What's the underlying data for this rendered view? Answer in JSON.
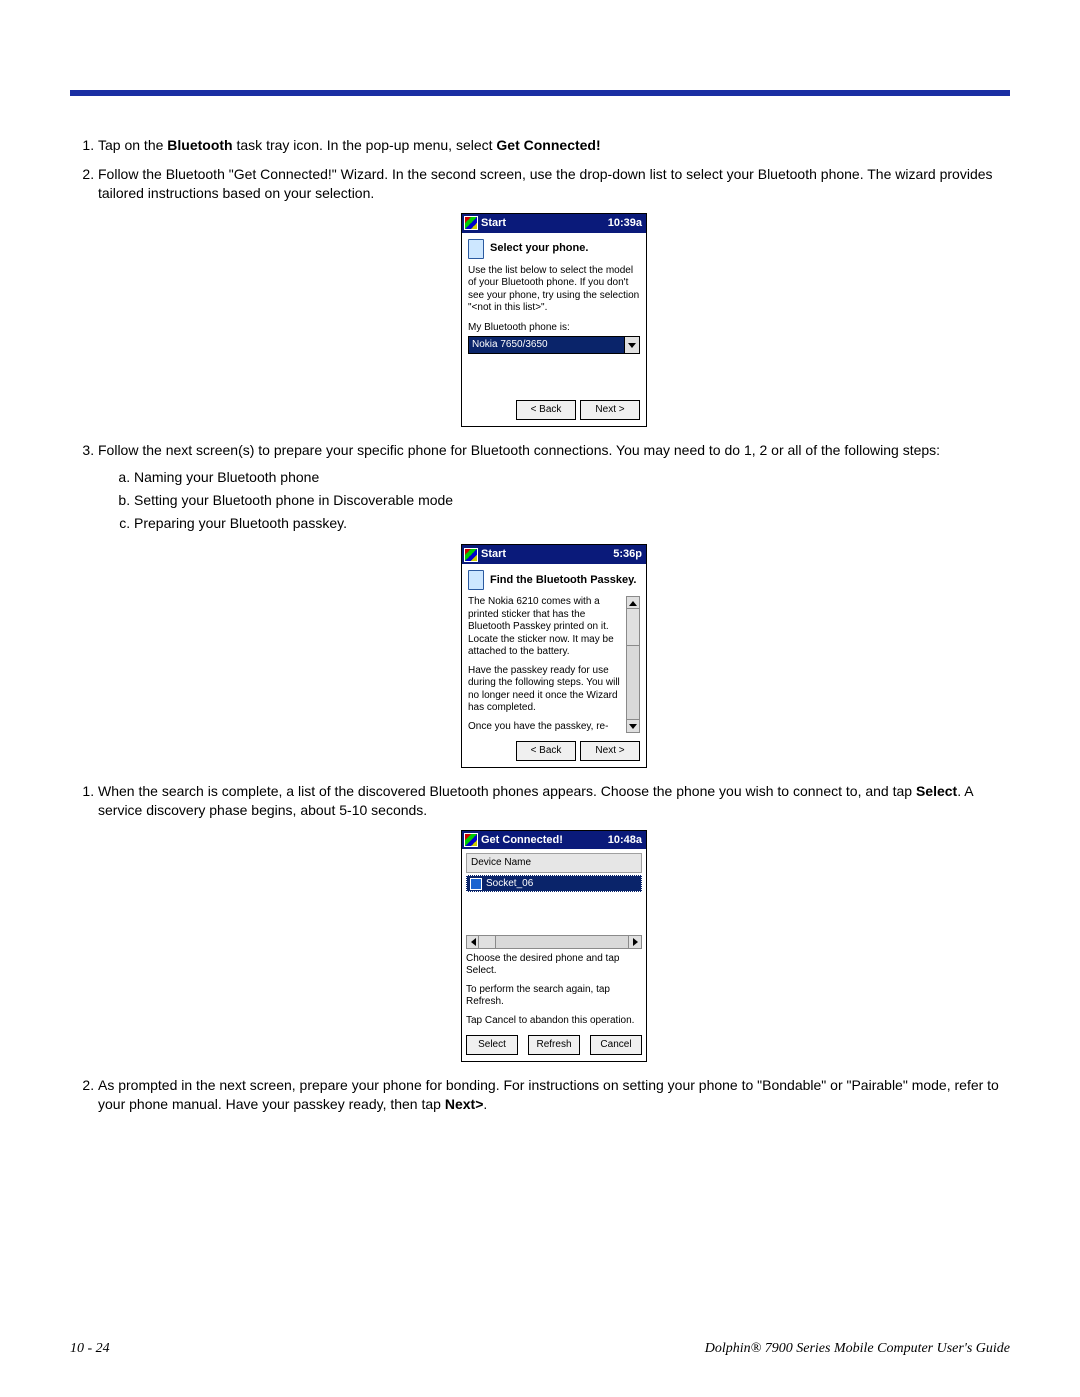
{
  "steps_a": {
    "s1_pre": "Tap on the ",
    "s1_bold1": "Bluetooth",
    "s1_mid": " task tray icon. In the pop-up menu, select ",
    "s1_bold2": "Get Connected!",
    "s2": "Follow the Bluetooth \"Get Connected!\" Wizard. In the second screen, use the drop-down list to select your Bluetooth phone. The wizard provides tailored instructions based on your selection.",
    "s3": "Follow the next screen(s) to prepare your specific phone for Bluetooth connections. You may need to do 1, 2 or all of the following steps:",
    "s3a": "Naming your Bluetooth phone",
    "s3b": "Setting your Bluetooth phone in Discoverable mode",
    "s3c": "Preparing your Bluetooth passkey."
  },
  "steps_b": {
    "s1_pre": "When the search is complete, a list of the discovered Bluetooth phones appears. Choose the phone you wish to connect to, and tap ",
    "s1_bold": "Select",
    "s1_post": ". A service discovery phase begins, about 5-10 seconds.",
    "s2_pre": "As prompted in the next screen, prepare your phone for bonding. For instructions on setting your phone to \"Bondable\" or \"Pairable\" mode, refer to your phone manual. Have your passkey ready, then tap ",
    "s2_bold": "Next>",
    "s2_post": "."
  },
  "pda1": {
    "title": "Start",
    "time": "10:39a",
    "heading": "Select your phone.",
    "text": "Use the list below to select the model of your Bluetooth phone. If you don't see your phone, try using the selection \"<not in this list>\".",
    "label": "My Bluetooth phone is:",
    "select_value": "Nokia 7650/3650",
    "btn_back": "< Back",
    "btn_next": "Next >"
  },
  "pda2": {
    "title": "Start",
    "time": "5:36p",
    "heading": "Find the Bluetooth Passkey.",
    "text1": "The Nokia 6210 comes with a printed sticker that has the Bluetooth Passkey printed on it. Locate the sticker now. It may be attached to the battery.",
    "text2": "Have the passkey ready for use during the following steps. You will no longer need it once the Wizard has completed.",
    "text3": "Once you have the passkey, re-",
    "btn_back": "< Back",
    "btn_next": "Next >"
  },
  "pda3": {
    "title": "Get Connected!",
    "time": "10:48a",
    "col_header": "Device Name",
    "row0": "Socket_06",
    "hint1": "Choose the desired phone and tap Select.",
    "hint2": "To perform the search again, tap Refresh.",
    "hint3": "Tap Cancel to abandon this operation.",
    "btn_select": "Select",
    "btn_refresh": "Refresh",
    "btn_cancel": "Cancel"
  },
  "footer": {
    "left": "10 - 24",
    "right": "Dolphin® 7900 Series Mobile Computer User's Guide"
  }
}
